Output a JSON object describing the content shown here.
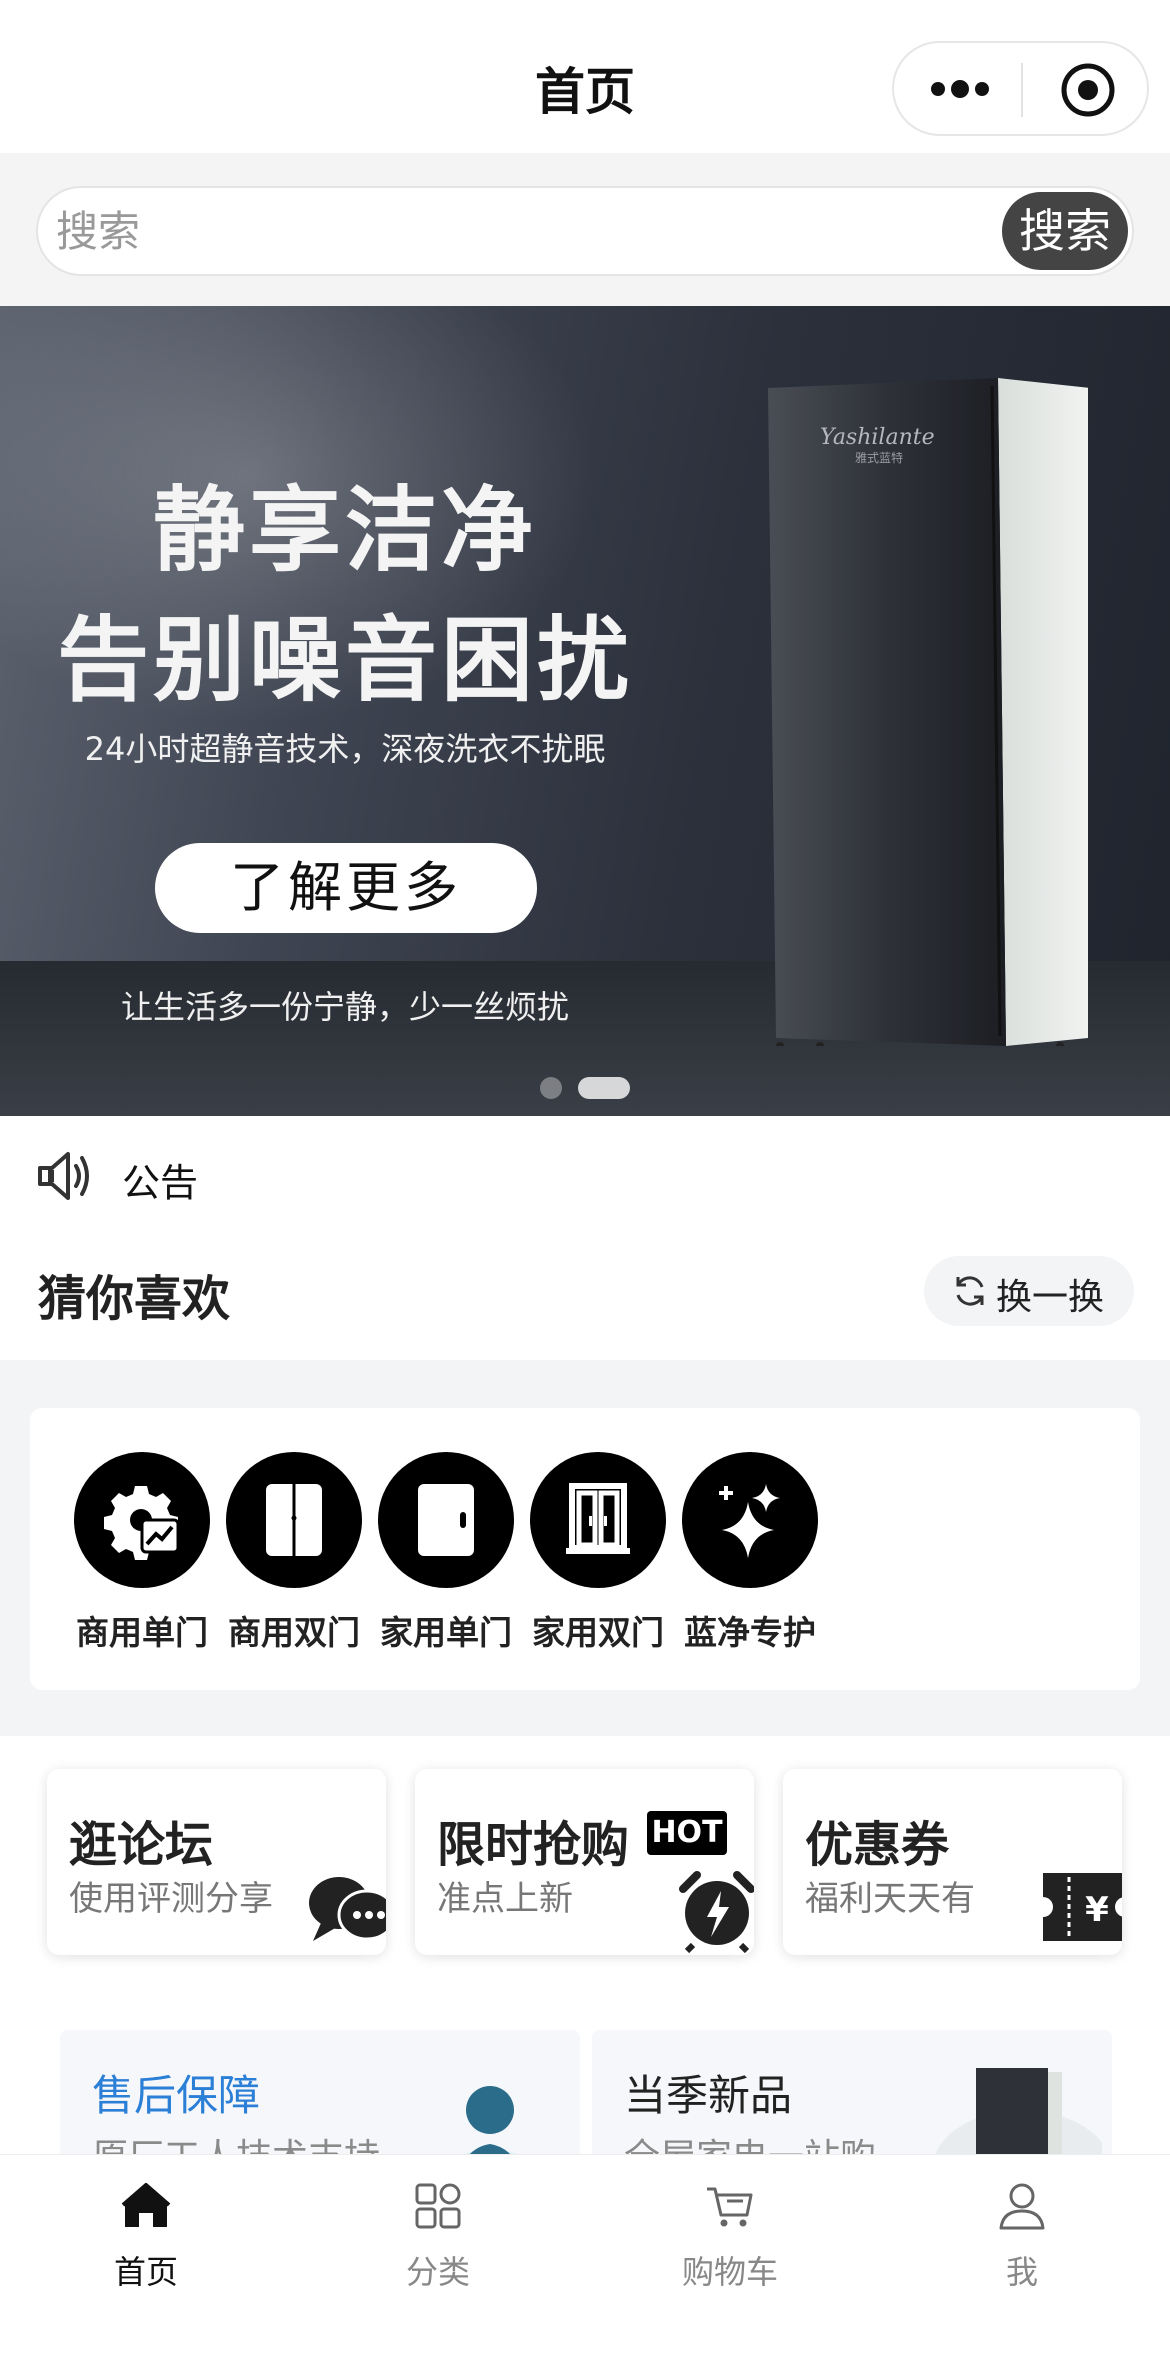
{
  "nav": {
    "title": "首页"
  },
  "search": {
    "placeholder": "搜索",
    "button_label": "搜索"
  },
  "banner": {
    "headline_1": "静享洁净",
    "headline_2": "告别噪音困扰",
    "subtitle": "24小时超静音技术，深夜洗衣不扰眠",
    "cta_label": "了解更多",
    "footer": "让生活多一份宁静，少一丝烦扰",
    "product_brand": "Yashilante",
    "product_brand_cn": "雅式蓝特",
    "slide_count": 2,
    "active_slide": 2
  },
  "notice": {
    "label": "公告"
  },
  "recommend": {
    "title": "猜你喜欢",
    "refresh_label": "换一换"
  },
  "categories": [
    {
      "label": "商用单门",
      "icon": "gear-chart-icon"
    },
    {
      "label": "商用双门",
      "icon": "double-door-icon"
    },
    {
      "label": "家用单门",
      "icon": "single-door-icon"
    },
    {
      "label": "家用双门",
      "icon": "wardrobe-icon"
    },
    {
      "label": "蓝净专护",
      "icon": "sparkle-icon"
    }
  ],
  "features": [
    {
      "title": "逛论坛",
      "subtitle": "使用评测分享",
      "icon": "chat-bubble-icon"
    },
    {
      "title": "限时抢购",
      "badge": "HOT",
      "subtitle": "准点上新",
      "icon": "alarm-clock-icon"
    },
    {
      "title": "优惠券",
      "subtitle": "福利天天有",
      "icon": "coupon-icon"
    }
  ],
  "promos": [
    {
      "title": "售后保障",
      "subtitle": "原厂工人技术支持",
      "title_color": "#2b7fd6"
    },
    {
      "title": "当季新品",
      "subtitle": "全屋家电一站购",
      "title_color": "#222222"
    }
  ],
  "tabbar": [
    {
      "label": "首页",
      "icon": "home-icon",
      "active": true
    },
    {
      "label": "分类",
      "icon": "category-icon",
      "active": false
    },
    {
      "label": "购物车",
      "icon": "cart-icon",
      "active": false
    },
    {
      "label": "我",
      "icon": "user-icon",
      "active": false
    }
  ]
}
